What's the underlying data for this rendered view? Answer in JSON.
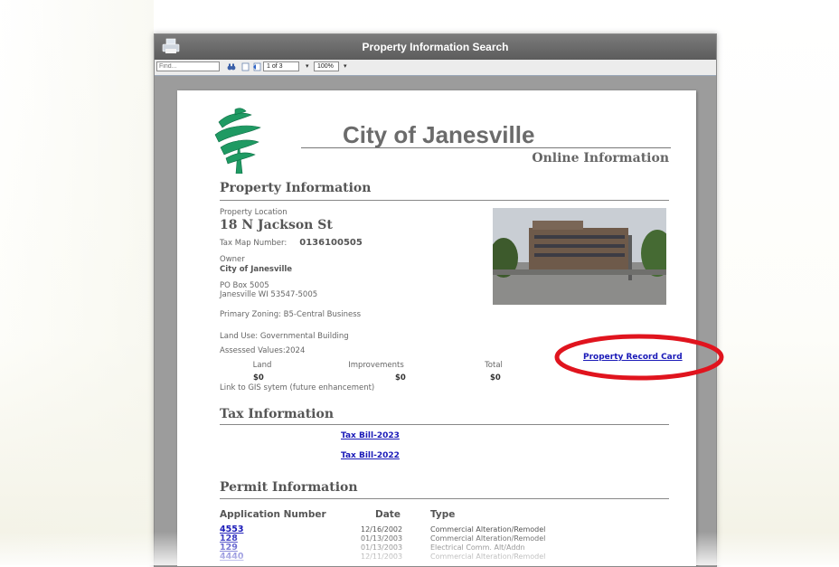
{
  "window": {
    "title": "Property Information Search"
  },
  "toolbar": {
    "find_placeholder": "Find...",
    "page_indicator": "1 of 3",
    "zoom": "100%"
  },
  "doc": {
    "city_title": "City of Janesville",
    "online_info": "Online Information",
    "property_section": "Property Information",
    "location_label": "Property Location",
    "location_value": "18 N Jackson St",
    "taxmap_label": "Tax Map Number:",
    "taxmap_value": "0136100505",
    "owner_label": "Owner",
    "owner_name": "City of Janesville",
    "owner_addr1": "PO Box 5005",
    "owner_addr2": "Janesville WI  53547-5005",
    "zoning": "Primary Zoning: B5-Central Business",
    "land_use": "Land Use: Governmental Building",
    "assessed": "Assessed Values:2024",
    "values": {
      "land_label": "Land",
      "improvements_label": "Improvements",
      "total_label": "Total",
      "land": "$0",
      "improvements": "$0",
      "total": "$0"
    },
    "gis_link": "Link to GIS sytem (future enhancement)",
    "record_card_link": "Property Record Card",
    "tax_section": "Tax Information",
    "tax_links": [
      "Tax Bill-2023",
      "Tax Bill-2022"
    ],
    "permit_section": "Permit Information",
    "permit_headers": {
      "number": "Application Number",
      "date": "Date",
      "type": "Type"
    },
    "permits": [
      {
        "number": "4553",
        "date": "12/16/2002",
        "type": "Commercial Alteration/Remodel"
      },
      {
        "number": "128",
        "date": "01/13/2003",
        "type": "Commercial Alteration/Remodel"
      },
      {
        "number": "129",
        "date": "01/13/2003",
        "type": "Electrical Comm. Alt/Addn"
      },
      {
        "number": "4440",
        "date": "12/11/2003",
        "type": "Commercial Alteration/Remodel"
      }
    ]
  },
  "colors": {
    "annotation_ellipse": "#e0141e",
    "link": "#1a1ab8",
    "titlebar": "#6a6a6a"
  }
}
